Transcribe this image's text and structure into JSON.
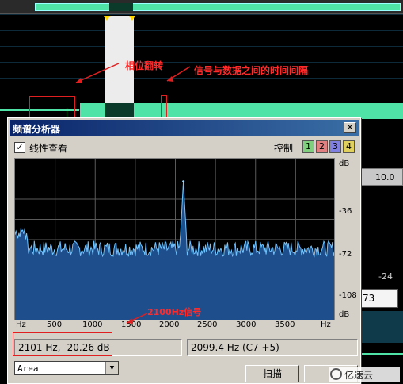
{
  "annotations": {
    "phase_flip": "相位翻转",
    "signal_data_gap": "信号与数据之间的时间间隔",
    "tone_2100": "2100Hz信号"
  },
  "dialog": {
    "title": "频谱分析器",
    "close": "✕",
    "linear_view_label": "线性查看",
    "linear_view_checked": "✓",
    "control_label": "控制",
    "control_buttons": [
      {
        "label": "1",
        "color": "#7fcf7f"
      },
      {
        "label": "2",
        "color": "#e08080"
      },
      {
        "label": "3",
        "color": "#8080e0"
      },
      {
        "label": "4",
        "color": "#e0d060"
      }
    ],
    "db_axis": [
      "dB",
      "-36",
      "-72",
      "-108",
      "dB"
    ],
    "freq_axis": [
      "Hz",
      "500",
      "1000",
      "1500",
      "2000",
      "2500",
      "3000",
      "3500",
      "Hz"
    ],
    "status_left": "2101 Hz, -20.26 dB",
    "status_right": "2099.4 Hz (C7 +5)",
    "window_type": "Area",
    "scan_button": "扫描"
  },
  "background": {
    "ruler_value": "10.0",
    "level_label": "-24",
    "input_value": "73"
  },
  "watermark": "亿速云",
  "chart_data": {
    "type": "area",
    "xlabel": "Hz",
    "ylabel": "dB",
    "x_range": [
      0,
      4000
    ],
    "y_range": [
      -144,
      0
    ],
    "peak": {
      "x": 2100,
      "y": -20.26
    },
    "noise_floor_db": -80,
    "grid": true
  }
}
